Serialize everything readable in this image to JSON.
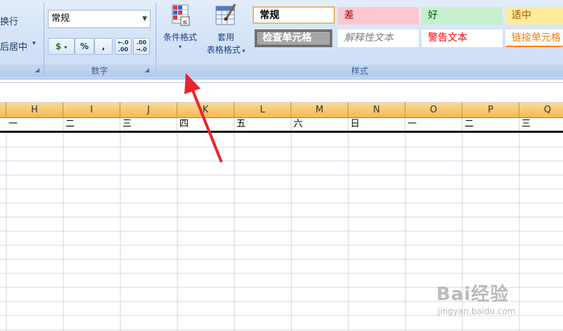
{
  "ribbon": {
    "alignment": {
      "wrap_text": "换行",
      "merge_center": "后居中"
    },
    "number": {
      "group_label": "数字",
      "format_value": "常规",
      "buttons": {
        "accounting": "$",
        "percent": "%",
        "comma": ",",
        "increase_decimal": "←.0 .00",
        "decrease_decimal": ".00 →.0"
      }
    },
    "conditional_format": {
      "label": "条件格式"
    },
    "table_format": {
      "label_line1": "套用",
      "label_line2": "表格格式"
    },
    "styles": {
      "group_label": "样式",
      "items": [
        {
          "label": "常规"
        },
        {
          "label": "差"
        },
        {
          "label": "好"
        },
        {
          "label": "适中"
        },
        {
          "label": "检查单元格"
        },
        {
          "label": "解释性文本"
        },
        {
          "label": "警告文本"
        },
        {
          "label": "链接单元格"
        }
      ]
    }
  },
  "sheet": {
    "columns": [
      "H",
      "I",
      "J",
      "K",
      "L",
      "M",
      "N",
      "O",
      "P",
      "Q"
    ],
    "row1": [
      "一",
      "二",
      "三",
      "四",
      "五",
      "六",
      "日",
      "一",
      "二",
      "三"
    ]
  },
  "watermark": {
    "brand": "Bai经验",
    "url": "jingyan.baidu.com"
  },
  "colors": {
    "accent": "#15428b",
    "column_header": "#f6b94f",
    "annotation_arrow": "#e8262b"
  }
}
